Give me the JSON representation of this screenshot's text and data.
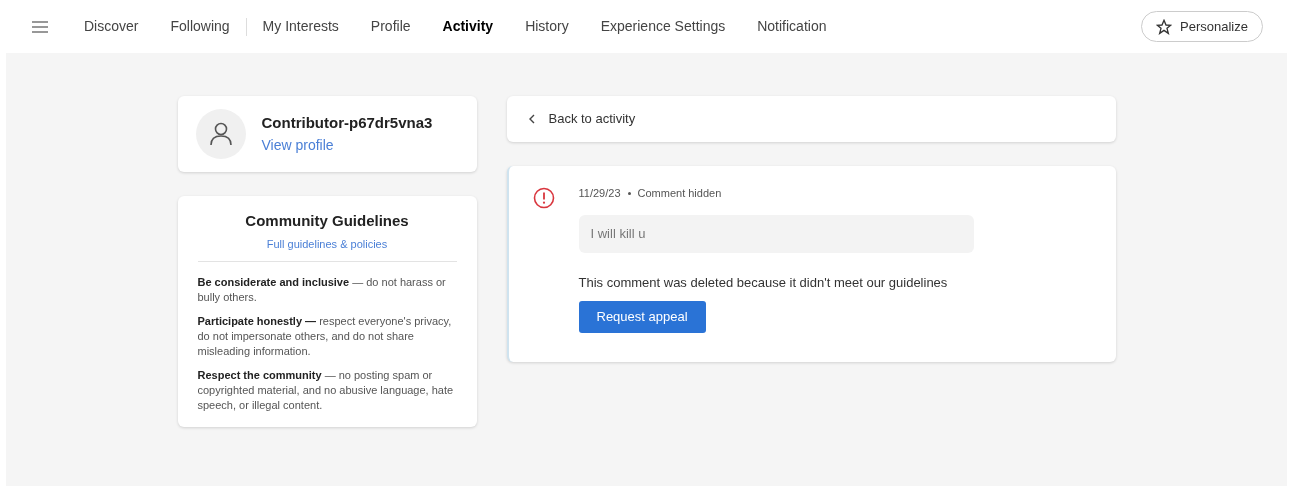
{
  "nav": {
    "tabs": [
      {
        "label": "Discover",
        "selected": false,
        "separator_after": false
      },
      {
        "label": "Following",
        "selected": false,
        "separator_after": true
      },
      {
        "label": "My Interests",
        "selected": false,
        "separator_after": false
      },
      {
        "label": "Profile",
        "selected": false,
        "separator_after": false
      },
      {
        "label": "Activity",
        "selected": true,
        "separator_after": false
      },
      {
        "label": "History",
        "selected": false,
        "separator_after": false
      },
      {
        "label": "Experience Settings",
        "selected": false,
        "separator_after": false
      },
      {
        "label": "Notification",
        "selected": false,
        "separator_after": false
      }
    ],
    "personalize_button": "Personalize"
  },
  "profile_card": {
    "name": "Contributor-p67dr5vna3",
    "link": "View profile"
  },
  "guidelines": {
    "title": "Community Guidelines",
    "link": "Full guidelines & policies",
    "rules": [
      "**Be considerate and inclusive** — do not harass or bully others.",
      "**Participate honestly —** respect everyone's privacy, do not impersonate others, and do not share misleading information.",
      "**Respect the community** — no posting spam or copyrighted material, and no abusive language, hate speech, or illegal content."
    ]
  },
  "back_link": "Back to activity",
  "comment": {
    "date": "11/29/23",
    "status": "Comment hidden",
    "text": "I will kill u",
    "message": "This comment was deleted because it didn't meet our guidelines",
    "button": "Request appeal"
  }
}
